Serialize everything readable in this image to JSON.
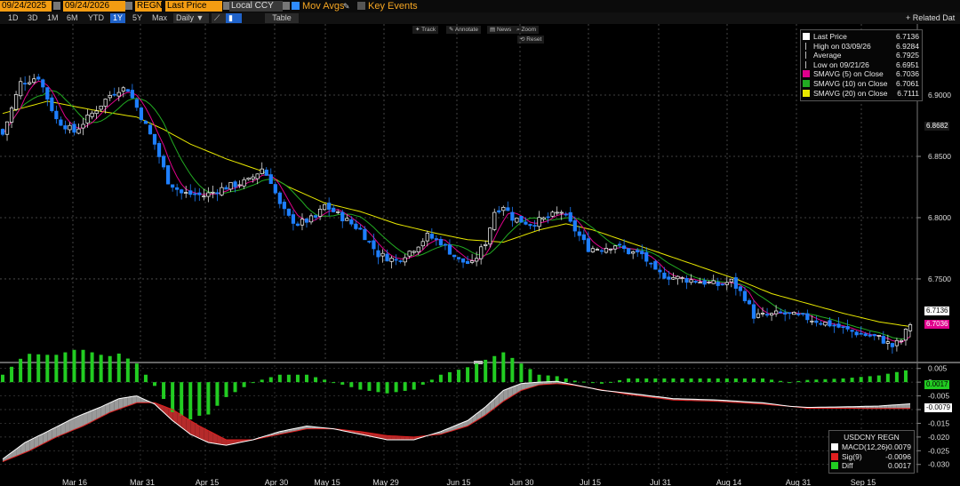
{
  "toolbar": {
    "start_date": "09/24/2025",
    "end_date": "09/24/2026",
    "security": "REGN",
    "field": "Last Price",
    "currency": "Local CCY",
    "mov_avgs_label": "Mov Avgs",
    "key_events_label": "Key Events",
    "related_label": "+ Related Dat"
  },
  "ranges": {
    "items": [
      "1D",
      "3D",
      "1M",
      "6M",
      "YTD",
      "1Y",
      "5Y",
      "Max"
    ],
    "selected": "1Y",
    "frequency": "Daily ▼",
    "table_label": "Table"
  },
  "chart_tools": {
    "track": "Track",
    "annotate": "Annotate",
    "news": "News",
    "zoom": "Zoom",
    "reset": "Reset"
  },
  "legend": {
    "items": [
      {
        "label": "Last Price",
        "value": "6.7136",
        "color": "#ffffff"
      },
      {
        "label": "High on 03/09/26",
        "value": "6.9284",
        "color": "#bbbbbb"
      },
      {
        "label": "Average",
        "value": "6.7925",
        "color": "#bbbbbb"
      },
      {
        "label": "Low on 09/21/26",
        "value": "6.6951",
        "color": "#bbbbbb"
      },
      {
        "label": "SMAVG (5)  on Close",
        "value": "6.7036",
        "color": "#e0008c"
      },
      {
        "label": "SMAVG (10)  on Close",
        "value": "6.7061",
        "color": "#22aa22"
      },
      {
        "label": "SMAVG (20)  on Close",
        "value": "6.7111",
        "color": "#e8e800"
      }
    ]
  },
  "price_tags": {
    "average": "6.8682",
    "last": "6.7136",
    "sma5": "6.7036"
  },
  "macd_legend": {
    "title": "USDCNY REGN",
    "items": [
      {
        "label": "MACD(12,26)",
        "value": "-0.0079",
        "color": "#ffffff"
      },
      {
        "label": "Sig(9)",
        "value": "-0.0096",
        "color": "#e02020"
      },
      {
        "label": "Diff",
        "value": "0.0017",
        "color": "#22cc22"
      }
    ]
  },
  "macd_tags": {
    "diff": "0.0017",
    "macd": "-0.0079"
  },
  "chart_data": {
    "type": "candlestick",
    "price_axis": {
      "ticks": [
        6.75,
        6.8,
        6.85,
        6.9
      ],
      "ylim": [
        6.684,
        6.958
      ]
    },
    "macd_axis": {
      "ticks": [
        0.005,
        0,
        -0.005,
        -0.01,
        -0.015,
        -0.02,
        -0.025,
        -0.03
      ],
      "ylim": [
        -0.033,
        0.0062
      ]
    },
    "x_tick_labels": [
      "Mar 16",
      "Mar 31",
      "Apr 15",
      "Apr 30",
      "May 15",
      "May 29",
      "Jun 15",
      "Jun 30",
      "Jul 15",
      "Jul 31",
      "Aug 14",
      "Aug 31",
      "Sep 15"
    ],
    "close_keypoints": [
      [
        0,
        6.868
      ],
      [
        4,
        6.91
      ],
      [
        8,
        6.915
      ],
      [
        12,
        6.88
      ],
      [
        16,
        6.87
      ],
      [
        20,
        6.885
      ],
      [
        24,
        6.9
      ],
      [
        26,
        6.905
      ],
      [
        28,
        6.905
      ],
      [
        30,
        6.89
      ],
      [
        32,
        6.875
      ],
      [
        34,
        6.86
      ],
      [
        37,
        6.83
      ],
      [
        40,
        6.82
      ],
      [
        45,
        6.818
      ],
      [
        50,
        6.825
      ],
      [
        55,
        6.83
      ],
      [
        58,
        6.84
      ],
      [
        60,
        6.83
      ],
      [
        62,
        6.81
      ],
      [
        64,
        6.8
      ],
      [
        66,
        6.795
      ],
      [
        70,
        6.8
      ],
      [
        72,
        6.81
      ],
      [
        76,
        6.8
      ],
      [
        80,
        6.79
      ],
      [
        84,
        6.77
      ],
      [
        88,
        6.765
      ],
      [
        92,
        6.775
      ],
      [
        95,
        6.785
      ],
      [
        98,
        6.78
      ],
      [
        102,
        6.765
      ],
      [
        105,
        6.762
      ],
      [
        108,
        6.78
      ],
      [
        110,
        6.805
      ],
      [
        112,
        6.81
      ],
      [
        114,
        6.8
      ],
      [
        118,
        6.795
      ],
      [
        122,
        6.8
      ],
      [
        125,
        6.805
      ],
      [
        128,
        6.79
      ],
      [
        131,
        6.775
      ],
      [
        134,
        6.775
      ],
      [
        137,
        6.778
      ],
      [
        140,
        6.772
      ],
      [
        143,
        6.77
      ],
      [
        146,
        6.755
      ],
      [
        149,
        6.752
      ],
      [
        152,
        6.75
      ],
      [
        156,
        6.748
      ],
      [
        160,
        6.745
      ],
      [
        163,
        6.748
      ],
      [
        166,
        6.735
      ],
      [
        168,
        6.72
      ],
      [
        171,
        6.72
      ],
      [
        174,
        6.722
      ],
      [
        177,
        6.72
      ],
      [
        180,
        6.718
      ],
      [
        183,
        6.715
      ],
      [
        186,
        6.712
      ],
      [
        189,
        6.708
      ],
      [
        192,
        6.705
      ],
      [
        196,
        6.702
      ],
      [
        199,
        6.695
      ],
      [
        201,
        6.7
      ],
      [
        203,
        6.7136
      ]
    ],
    "sma20_keypoints": [
      [
        0,
        6.885
      ],
      [
        10,
        6.895
      ],
      [
        20,
        6.888
      ],
      [
        30,
        6.882
      ],
      [
        36,
        6.872
      ],
      [
        42,
        6.86
      ],
      [
        50,
        6.848
      ],
      [
        58,
        6.838
      ],
      [
        64,
        6.825
      ],
      [
        72,
        6.812
      ],
      [
        80,
        6.805
      ],
      [
        88,
        6.795
      ],
      [
        96,
        6.788
      ],
      [
        104,
        6.782
      ],
      [
        112,
        6.78
      ],
      [
        120,
        6.79
      ],
      [
        126,
        6.795
      ],
      [
        132,
        6.79
      ],
      [
        140,
        6.78
      ],
      [
        148,
        6.77
      ],
      [
        156,
        6.76
      ],
      [
        164,
        6.75
      ],
      [
        172,
        6.738
      ],
      [
        180,
        6.73
      ],
      [
        188,
        6.722
      ],
      [
        196,
        6.715
      ],
      [
        203,
        6.7111
      ]
    ],
    "macd_keypoints": [
      [
        0,
        -0.028
      ],
      [
        5,
        -0.022
      ],
      [
        10,
        -0.018
      ],
      [
        16,
        -0.013
      ],
      [
        22,
        -0.009
      ],
      [
        26,
        -0.006
      ],
      [
        30,
        -0.005
      ],
      [
        34,
        -0.008
      ],
      [
        38,
        -0.014
      ],
      [
        42,
        -0.019
      ],
      [
        46,
        -0.022
      ],
      [
        50,
        -0.023
      ],
      [
        56,
        -0.021
      ],
      [
        62,
        -0.018
      ],
      [
        68,
        -0.016
      ],
      [
        74,
        -0.017
      ],
      [
        80,
        -0.019
      ],
      [
        86,
        -0.021
      ],
      [
        92,
        -0.021
      ],
      [
        98,
        -0.018
      ],
      [
        104,
        -0.014
      ],
      [
        108,
        -0.009
      ],
      [
        112,
        -0.003
      ],
      [
        116,
        -0.0005
      ],
      [
        120,
        0
      ],
      [
        124,
        0.0003
      ],
      [
        128,
        -0.001
      ],
      [
        134,
        -0.003
      ],
      [
        140,
        -0.004
      ],
      [
        150,
        -0.006
      ],
      [
        160,
        -0.0065
      ],
      [
        170,
        -0.0075
      ],
      [
        176,
        -0.0088
      ],
      [
        180,
        -0.0092
      ],
      [
        188,
        -0.009
      ],
      [
        196,
        -0.0087
      ],
      [
        203,
        -0.0079
      ]
    ],
    "signal_keypoints": [
      [
        0,
        -0.029
      ],
      [
        6,
        -0.025
      ],
      [
        12,
        -0.02
      ],
      [
        18,
        -0.016
      ],
      [
        24,
        -0.011
      ],
      [
        30,
        -0.0075
      ],
      [
        34,
        -0.0075
      ],
      [
        38,
        -0.01
      ],
      [
        44,
        -0.016
      ],
      [
        50,
        -0.021
      ],
      [
        56,
        -0.021
      ],
      [
        62,
        -0.019
      ],
      [
        68,
        -0.017
      ],
      [
        74,
        -0.017
      ],
      [
        80,
        -0.018
      ],
      [
        86,
        -0.0195
      ],
      [
        92,
        -0.02
      ],
      [
        98,
        -0.019
      ],
      [
        104,
        -0.016
      ],
      [
        108,
        -0.012
      ],
      [
        112,
        -0.007
      ],
      [
        116,
        -0.003
      ],
      [
        120,
        -0.001
      ],
      [
        124,
        -0.0005
      ],
      [
        128,
        -0.0012
      ],
      [
        134,
        -0.0028
      ],
      [
        140,
        -0.0045
      ],
      [
        150,
        -0.0065
      ],
      [
        160,
        -0.007
      ],
      [
        170,
        -0.008
      ],
      [
        176,
        -0.0088
      ],
      [
        180,
        -0.0095
      ],
      [
        188,
        -0.0095
      ],
      [
        196,
        -0.0096
      ],
      [
        203,
        -0.0096
      ]
    ],
    "n_bars": 204,
    "colors": {
      "up": "#ffffff",
      "down": "#1e7fff",
      "sma5": "#e0008c",
      "sma10": "#22aa22",
      "sma20": "#e8e800",
      "macd": "#ffffff",
      "signal": "#e02020",
      "diff": "#22cc22"
    }
  }
}
